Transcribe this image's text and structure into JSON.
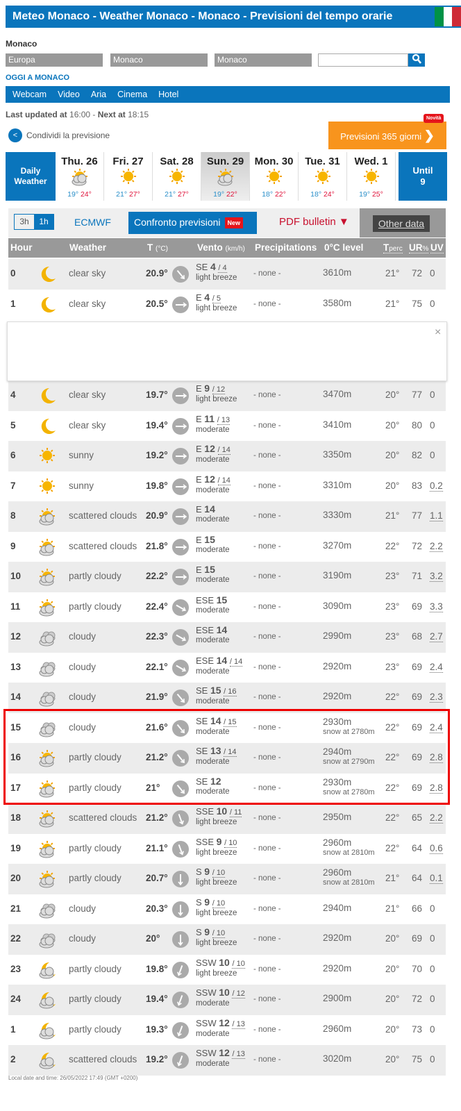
{
  "header": {
    "title": "Meteo Monaco - Weather Monaco - Monaco - Previsioni del tempo orarie",
    "flag_colors": [
      "#009246",
      "#ffffff",
      "#ce2b37"
    ]
  },
  "location": {
    "name": "Monaco",
    "continent": "Europa",
    "country": "Monaco",
    "city": "Monaco",
    "search_value": "",
    "search_icon": "search-icon"
  },
  "oggi": "OGGI A MONACO",
  "nav": [
    "Webcam",
    "Video",
    "Aria",
    "Cinema",
    "Hotel"
  ],
  "update": {
    "last_label": "Last updated at",
    "last": "16:00",
    "sep": " - ",
    "next_label": "Next at",
    "next": "18:15"
  },
  "share": "Condividi la previsione",
  "promo": {
    "label": "Previsioni 365 giorni",
    "badge": "Novità"
  },
  "days": {
    "daily_label": "Daily Weather",
    "until_label": "Until",
    "until_value": "9",
    "items": [
      {
        "name": "Thu. 26",
        "icon": "partly-cloudy",
        "min": "19°",
        "max": "24°"
      },
      {
        "name": "Fri. 27",
        "icon": "sunny",
        "min": "21°",
        "max": "27°"
      },
      {
        "name": "Sat. 28",
        "icon": "sunny",
        "min": "21°",
        "max": "27°"
      },
      {
        "name": "Sun. 29",
        "icon": "partly-cloudy",
        "min": "19°",
        "max": "22°",
        "selected": true
      },
      {
        "name": "Mon. 30",
        "icon": "sunny",
        "min": "18°",
        "max": "22°"
      },
      {
        "name": "Tue. 31",
        "icon": "sunny",
        "min": "18°",
        "max": "24°"
      },
      {
        "name": "Wed. 1",
        "icon": "sunny",
        "min": "19°",
        "max": "25°"
      }
    ]
  },
  "tabs": {
    "t3h": "3h",
    "t1h": "1h",
    "ecmwf": "ECMWF",
    "confronto": "Confronto previsioni",
    "new_badge": "New",
    "pdf": "PDF bulletin ▼",
    "other": "Other data"
  },
  "columns": {
    "hour": "Hour",
    "weather": "Weather",
    "temp": "T",
    "temp_unit": "(°C)",
    "wind": "Vento",
    "wind_unit": "(km/h)",
    "precip": "Precipitations",
    "level": "0°C level",
    "tperc": "T",
    "tperc_sub": "perc",
    "ur": "UR",
    "ur_unit": "%",
    "uv": "UV"
  },
  "ad": {
    "close": "×"
  },
  "rows": [
    {
      "hour": "0",
      "icon": "moon",
      "weather": "clear sky",
      "temp": "20.9°",
      "dir": "SE",
      "speed": "4",
      "gust": "4",
      "desc": "light breeze",
      "precip": "- none -",
      "level": "3610m",
      "snow": "",
      "tperc": "21°",
      "ur": "72",
      "uv": "0"
    },
    {
      "hour": "1",
      "icon": "moon",
      "weather": "clear sky",
      "temp": "20.5°",
      "dir": "E",
      "speed": "4",
      "gust": "5",
      "desc": "light breeze",
      "precip": "- none -",
      "level": "3580m",
      "snow": "",
      "tperc": "21°",
      "ur": "75",
      "uv": "0"
    },
    {
      "hour": "4",
      "icon": "moon",
      "weather": "clear sky",
      "temp": "19.7°",
      "dir": "E",
      "speed": "9",
      "gust": "12",
      "desc": "light breeze",
      "precip": "- none -",
      "level": "3470m",
      "snow": "",
      "tperc": "20°",
      "ur": "77",
      "uv": "0"
    },
    {
      "hour": "5",
      "icon": "moon",
      "weather": "clear sky",
      "temp": "19.4°",
      "dir": "E",
      "speed": "11",
      "gust": "13",
      "desc": "moderate",
      "precip": "- none -",
      "level": "3410m",
      "snow": "",
      "tperc": "20°",
      "ur": "80",
      "uv": "0"
    },
    {
      "hour": "6",
      "icon": "sun",
      "weather": "sunny",
      "temp": "19.2°",
      "dir": "E",
      "speed": "12",
      "gust": "14",
      "desc": "moderate",
      "precip": "- none -",
      "level": "3350m",
      "snow": "",
      "tperc": "20°",
      "ur": "82",
      "uv": "0"
    },
    {
      "hour": "7",
      "icon": "sun",
      "weather": "sunny",
      "temp": "19.8°",
      "dir": "E",
      "speed": "12",
      "gust": "14",
      "desc": "moderate",
      "precip": "- none -",
      "level": "3310m",
      "snow": "",
      "tperc": "20°",
      "ur": "83",
      "uv": "0.2"
    },
    {
      "hour": "8",
      "icon": "sun-cloud",
      "weather": "scattered clouds",
      "temp": "20.9°",
      "dir": "E",
      "speed": "14",
      "gust": "",
      "desc": "moderate",
      "precip": "- none -",
      "level": "3330m",
      "snow": "",
      "tperc": "21°",
      "ur": "77",
      "uv": "1.1"
    },
    {
      "hour": "9",
      "icon": "sun-cloud",
      "weather": "scattered clouds",
      "temp": "21.8°",
      "dir": "E",
      "speed": "15",
      "gust": "",
      "desc": "moderate",
      "precip": "- none -",
      "level": "3270m",
      "snow": "",
      "tperc": "22°",
      "ur": "72",
      "uv": "2.2"
    },
    {
      "hour": "10",
      "icon": "sun-cloud",
      "weather": "partly cloudy",
      "temp": "22.2°",
      "dir": "E",
      "speed": "15",
      "gust": "",
      "desc": "moderate",
      "precip": "- none -",
      "level": "3190m",
      "snow": "",
      "tperc": "23°",
      "ur": "71",
      "uv": "3.2"
    },
    {
      "hour": "11",
      "icon": "sun-cloud",
      "weather": "partly cloudy",
      "temp": "22.4°",
      "dir": "ESE",
      "speed": "15",
      "gust": "",
      "desc": "moderate",
      "precip": "- none -",
      "level": "3090m",
      "snow": "",
      "tperc": "23°",
      "ur": "69",
      "uv": "3.3"
    },
    {
      "hour": "12",
      "icon": "cloud",
      "weather": "cloudy",
      "temp": "22.3°",
      "dir": "ESE",
      "speed": "14",
      "gust": "",
      "desc": "moderate",
      "precip": "- none -",
      "level": "2990m",
      "snow": "",
      "tperc": "23°",
      "ur": "68",
      "uv": "2.7"
    },
    {
      "hour": "13",
      "icon": "cloud",
      "weather": "cloudy",
      "temp": "22.1°",
      "dir": "ESE",
      "speed": "14",
      "gust": "14",
      "desc": "moderate",
      "precip": "- none -",
      "level": "2920m",
      "snow": "",
      "tperc": "23°",
      "ur": "69",
      "uv": "2.4"
    },
    {
      "hour": "14",
      "icon": "cloud",
      "weather": "cloudy",
      "temp": "21.9°",
      "dir": "SE",
      "speed": "15",
      "gust": "16",
      "desc": "moderate",
      "precip": "- none -",
      "level": "2920m",
      "snow": "",
      "tperc": "22°",
      "ur": "69",
      "uv": "2.3"
    },
    {
      "hour": "15",
      "icon": "cloud",
      "weather": "cloudy",
      "temp": "21.6°",
      "dir": "SE",
      "speed": "14",
      "gust": "15",
      "desc": "moderate",
      "precip": "- none -",
      "level": "2930m",
      "snow": "snow at 2780m",
      "tperc": "22°",
      "ur": "69",
      "uv": "2.4"
    },
    {
      "hour": "16",
      "icon": "sun-cloud",
      "weather": "partly cloudy",
      "temp": "21.2°",
      "dir": "SE",
      "speed": "13",
      "gust": "14",
      "desc": "moderate",
      "precip": "- none -",
      "level": "2940m",
      "snow": "snow at 2790m",
      "tperc": "22°",
      "ur": "69",
      "uv": "2.8"
    },
    {
      "hour": "17",
      "icon": "sun-cloud",
      "weather": "partly cloudy",
      "temp": "21°",
      "dir": "SE",
      "speed": "12",
      "gust": "",
      "desc": "moderate",
      "precip": "- none -",
      "level": "2930m",
      "snow": "snow at 2780m",
      "tperc": "22°",
      "ur": "69",
      "uv": "2.8"
    },
    {
      "hour": "18",
      "icon": "sun-cloud",
      "weather": "scattered clouds",
      "temp": "21.2°",
      "dir": "SSE",
      "speed": "10",
      "gust": "11",
      "desc": "light breeze",
      "precip": "- none -",
      "level": "2950m",
      "snow": "",
      "tperc": "22°",
      "ur": "65",
      "uv": "2.2"
    },
    {
      "hour": "19",
      "icon": "sun-cloud",
      "weather": "partly cloudy",
      "temp": "21.1°",
      "dir": "SSE",
      "speed": "9",
      "gust": "10",
      "desc": "light breeze",
      "precip": "- none -",
      "level": "2960m",
      "snow": "snow at 2810m",
      "tperc": "22°",
      "ur": "64",
      "uv": "0.6"
    },
    {
      "hour": "20",
      "icon": "sun-cloud",
      "weather": "partly cloudy",
      "temp": "20.7°",
      "dir": "S",
      "speed": "9",
      "gust": "10",
      "desc": "light breeze",
      "precip": "- none -",
      "level": "2960m",
      "snow": "snow at 2810m",
      "tperc": "21°",
      "ur": "64",
      "uv": "0.1"
    },
    {
      "hour": "21",
      "icon": "cloud",
      "weather": "cloudy",
      "temp": "20.3°",
      "dir": "S",
      "speed": "9",
      "gust": "10",
      "desc": "light breeze",
      "precip": "- none -",
      "level": "2940m",
      "snow": "",
      "tperc": "21°",
      "ur": "66",
      "uv": "0"
    },
    {
      "hour": "22",
      "icon": "cloud",
      "weather": "cloudy",
      "temp": "20°",
      "dir": "S",
      "speed": "9",
      "gust": "10",
      "desc": "light breeze",
      "precip": "- none -",
      "level": "2920m",
      "snow": "",
      "tperc": "20°",
      "ur": "69",
      "uv": "0"
    },
    {
      "hour": "23",
      "icon": "moon-cloud",
      "weather": "partly cloudy",
      "temp": "19.8°",
      "dir": "SSW",
      "speed": "10",
      "gust": "10",
      "desc": "light breeze",
      "precip": "- none -",
      "level": "2920m",
      "snow": "",
      "tperc": "20°",
      "ur": "70",
      "uv": "0"
    },
    {
      "hour": "24",
      "icon": "moon-cloud",
      "weather": "partly cloudy",
      "temp": "19.4°",
      "dir": "SSW",
      "speed": "10",
      "gust": "12",
      "desc": "moderate",
      "precip": "- none -",
      "level": "2900m",
      "snow": "",
      "tperc": "20°",
      "ur": "72",
      "uv": "0"
    },
    {
      "hour": "1",
      "icon": "moon-cloud",
      "weather": "partly cloudy",
      "temp": "19.3°",
      "dir": "SSW",
      "speed": "12",
      "gust": "13",
      "desc": "moderate",
      "precip": "- none -",
      "level": "2960m",
      "snow": "",
      "tperc": "20°",
      "ur": "73",
      "uv": "0"
    },
    {
      "hour": "2",
      "icon": "moon-cloud",
      "weather": "scattered clouds",
      "temp": "19.2°",
      "dir": "SSW",
      "speed": "12",
      "gust": "13",
      "desc": "moderate",
      "precip": "- none -",
      "level": "3020m",
      "snow": "",
      "tperc": "20°",
      "ur": "75",
      "uv": "0"
    }
  ],
  "highlight_color": "#e00000",
  "footer": "Local date and time: 26/05/2022 17:49 (GMT +0200)"
}
